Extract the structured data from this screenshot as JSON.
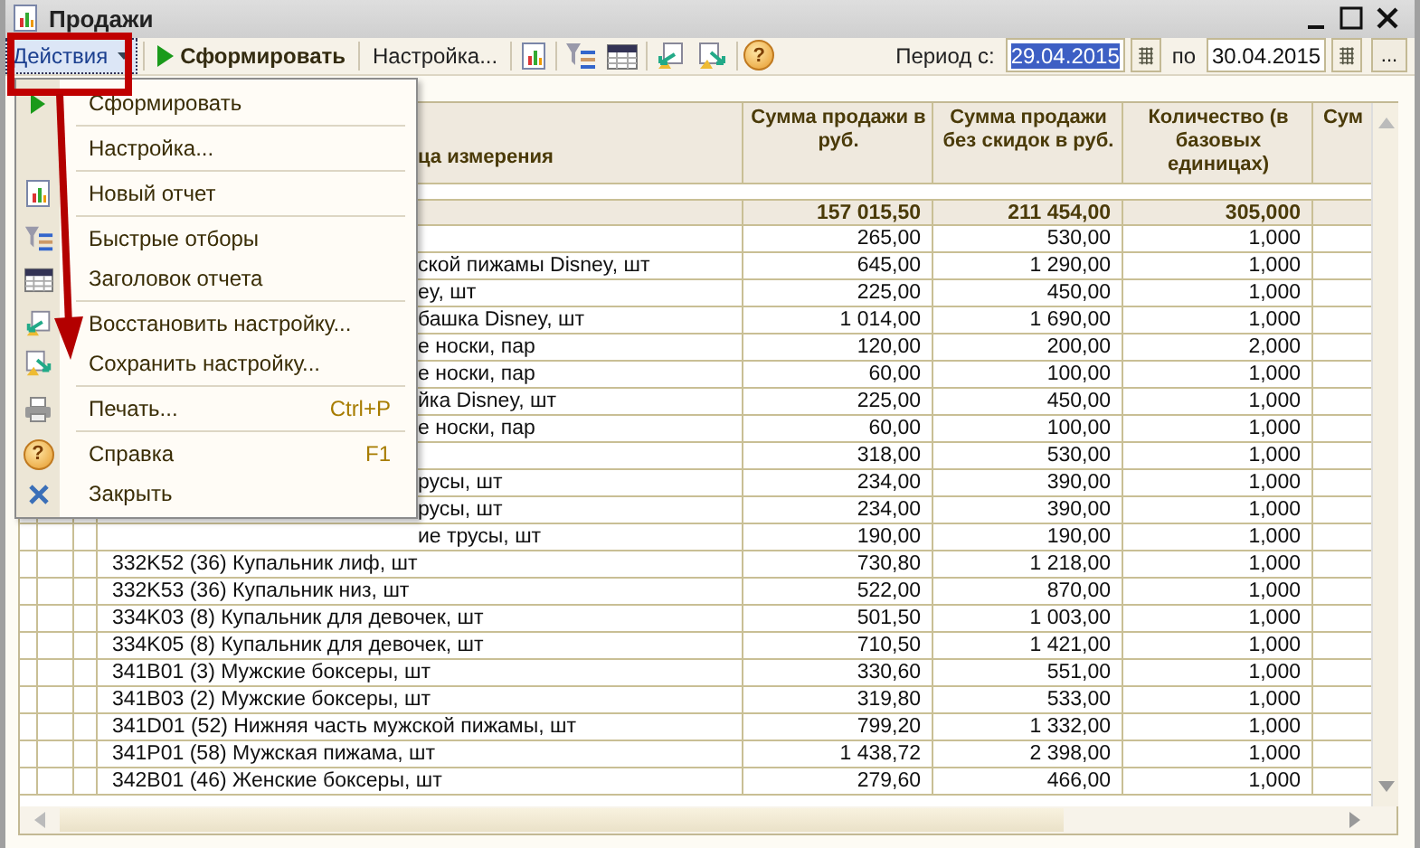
{
  "window": {
    "title": "Продажи"
  },
  "toolbar": {
    "actions": {
      "label": "Действия",
      "selected": true
    },
    "generate": "Сформировать",
    "settings": "Настройка...",
    "help_icon": "?"
  },
  "period": {
    "label": "Период с:",
    "from": "29.04.2015",
    "from_text_selected": true,
    "to_label": "по",
    "to": "30.04.2015",
    "more": "..."
  },
  "menu": {
    "groups": [
      [
        {
          "label": "Сформировать"
        }
      ],
      [
        {
          "label": "Настройка..."
        }
      ],
      [
        {
          "label": "Новый отчет"
        }
      ],
      [
        {
          "label": "Быстрые отборы"
        },
        {
          "label": "Заголовок отчета"
        }
      ],
      [
        {
          "label": "Восстановить настройку..."
        },
        {
          "label": "Сохранить настройку..."
        }
      ],
      [
        {
          "label": "Печать...",
          "shortcut": "Ctrl+P"
        }
      ],
      [
        {
          "label": "Справка",
          "shortcut": "F1",
          "icon_text": "?"
        },
        {
          "label": "Закрыть"
        }
      ]
    ]
  },
  "table": {
    "columns": [
      {
        "title": "ца измерения",
        "kind": "partial"
      },
      {
        "title": "Сумма продажи в руб.",
        "kind": "full"
      },
      {
        "title": "Сумма продажи без скидок в руб.",
        "kind": "full"
      },
      {
        "title": "Количество (в базовых единицах)",
        "kind": "full"
      },
      {
        "title": "Сум",
        "kind": "full"
      }
    ],
    "totals": [
      "157 015,50",
      "211 454,00",
      "305,000"
    ],
    "rows": [
      {
        "kind": "partial",
        "values": [
          "265,00",
          "530,00",
          "1,000"
        ]
      },
      {
        "kind": "partial",
        "name": "ской пижамы Disney, шт",
        "values": [
          "645,00",
          "1 290,00",
          "1,000"
        ]
      },
      {
        "kind": "partial",
        "name": "ey, шт",
        "values": [
          "225,00",
          "450,00",
          "1,000"
        ]
      },
      {
        "kind": "partial",
        "name": "башка Disney, шт",
        "values": [
          "1 014,00",
          "1 690,00",
          "1,000"
        ]
      },
      {
        "kind": "partial",
        "name": "е носки, пар",
        "values": [
          "120,00",
          "200,00",
          "2,000"
        ]
      },
      {
        "kind": "partial",
        "name": "е носки, пар",
        "values": [
          "60,00",
          "100,00",
          "1,000"
        ]
      },
      {
        "kind": "partial",
        "name": "йка Disney, шт",
        "values": [
          "225,00",
          "450,00",
          "1,000"
        ]
      },
      {
        "kind": "partial",
        "name": "е носки, пар",
        "values": [
          "60,00",
          "100,00",
          "1,000"
        ]
      },
      {
        "kind": "partial",
        "values": [
          "318,00",
          "530,00",
          "1,000"
        ]
      },
      {
        "kind": "partial",
        "name": "русы, шт",
        "values": [
          "234,00",
          "390,00",
          "1,000"
        ]
      },
      {
        "kind": "partial",
        "name": "русы, шт",
        "values": [
          "234,00",
          "390,00",
          "1,000"
        ]
      },
      {
        "kind": "partial",
        "name": "ие трусы, шт",
        "values": [
          "190,00",
          "190,00",
          "1,000"
        ]
      },
      {
        "kind": "full",
        "name": "332K52 (36) Купальник лиф, шт",
        "values": [
          "730,80",
          "1 218,00",
          "1,000"
        ]
      },
      {
        "kind": "full",
        "name": "332K53 (36) Купальник низ, шт",
        "values": [
          "522,00",
          "870,00",
          "1,000"
        ]
      },
      {
        "kind": "full",
        "name": "334K03 (8) Купальник для девочек, шт",
        "values": [
          "501,50",
          "1 003,00",
          "1,000"
        ]
      },
      {
        "kind": "full",
        "name": "334K05 (8) Купальник для девочек, шт",
        "values": [
          "710,50",
          "1 421,00",
          "1,000"
        ]
      },
      {
        "kind": "full",
        "name": "341B01 (3) Мужские боксеры, шт",
        "values": [
          "330,60",
          "551,00",
          "1,000"
        ]
      },
      {
        "kind": "full",
        "name": "341B03 (2) Мужские боксеры, шт",
        "values": [
          "319,80",
          "533,00",
          "1,000"
        ]
      },
      {
        "kind": "full",
        "name": "341D01 (52) Нижняя часть мужской пижамы, шт",
        "values": [
          "799,20",
          "1 332,00",
          "1,000"
        ]
      },
      {
        "kind": "full",
        "name": "341P01 (58) Мужская пижама, шт",
        "values": [
          "1 438,72",
          "2 398,00",
          "1,000"
        ]
      },
      {
        "kind": "full",
        "name": "342B01 (46) Женские боксеры, шт",
        "values": [
          "279,60",
          "466,00",
          "1,000"
        ]
      }
    ]
  }
}
